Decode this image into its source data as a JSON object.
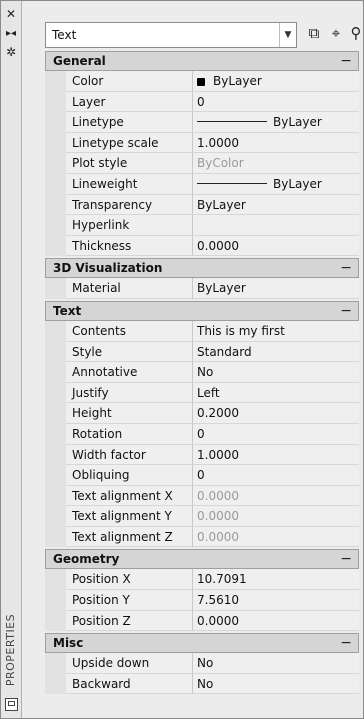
{
  "palette": {
    "title": "PROPERTIES"
  },
  "selector": {
    "value": "Text"
  },
  "toolbar_icons": [
    "toggle-pickadd-icon",
    "select-objects-icon",
    "quick-select-icon"
  ],
  "sections": [
    {
      "title": "General",
      "rows": [
        {
          "name": "Color",
          "value": "ByLayer"
        },
        {
          "name": "Layer",
          "value": "0"
        },
        {
          "name": "Linetype",
          "value": "ByLayer"
        },
        {
          "name": "Linetype scale",
          "value": "1.0000"
        },
        {
          "name": "Plot style",
          "value": "ByColor"
        },
        {
          "name": "Lineweight",
          "value": "ByLayer"
        },
        {
          "name": "Transparency",
          "value": "ByLayer"
        },
        {
          "name": "Hyperlink",
          "value": ""
        },
        {
          "name": "Thickness",
          "value": "0.0000"
        }
      ]
    },
    {
      "title": "3D Visualization",
      "rows": [
        {
          "name": "Material",
          "value": "ByLayer"
        }
      ]
    },
    {
      "title": "Text",
      "rows": [
        {
          "name": "Contents",
          "value": "This is my first"
        },
        {
          "name": "Style",
          "value": "Standard"
        },
        {
          "name": "Annotative",
          "value": "No"
        },
        {
          "name": "Justify",
          "value": "Left"
        },
        {
          "name": "Height",
          "value": "0.2000"
        },
        {
          "name": "Rotation",
          "value": "0"
        },
        {
          "name": "Width factor",
          "value": "1.0000"
        },
        {
          "name": "Obliquing",
          "value": "0"
        },
        {
          "name": "Text alignment X",
          "value": "0.0000"
        },
        {
          "name": "Text alignment Y",
          "value": "0.0000"
        },
        {
          "name": "Text alignment Z",
          "value": "0.0000"
        }
      ]
    },
    {
      "title": "Geometry",
      "rows": [
        {
          "name": "Position X",
          "value": "10.7091"
        },
        {
          "name": "Position Y",
          "value": "7.5610"
        },
        {
          "name": "Position Z",
          "value": "0.0000"
        }
      ]
    },
    {
      "title": "Misc",
      "rows": [
        {
          "name": "Upside down",
          "value": "No"
        },
        {
          "name": "Backward",
          "value": "No"
        }
      ]
    }
  ]
}
